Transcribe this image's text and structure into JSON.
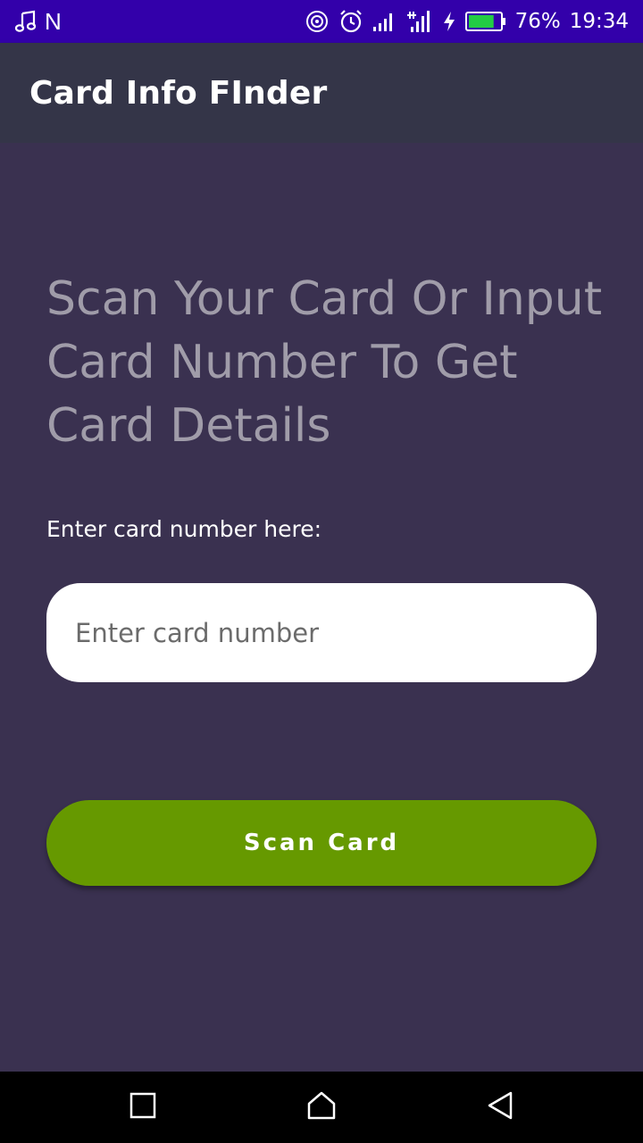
{
  "status_bar": {
    "left_icons": [
      "music-note-icon",
      "n-letter"
    ],
    "n_label": "N",
    "right_icons": [
      "hotspot-icon",
      "alarm-icon",
      "signal-icon",
      "signal-4g-icon",
      "charging-icon",
      "battery-icon"
    ],
    "battery_percent": "76%",
    "battery_level": 0.76,
    "time": "19:34",
    "background_color": "#3300aa"
  },
  "app_bar": {
    "title": "Card Info FInder",
    "background_color": "#343548"
  },
  "main": {
    "headline": "Scan Your Card Or Input Card Number To Get Card Details",
    "field_label": "Enter card number here:",
    "card_input": {
      "placeholder": "Enter card number",
      "value": ""
    },
    "scan_button_label": "Scan Card",
    "background_color": "#3a3150",
    "accent_color": "#669900"
  },
  "nav_bar": {
    "items": [
      "recent-apps-icon",
      "home-icon",
      "back-icon"
    ]
  }
}
